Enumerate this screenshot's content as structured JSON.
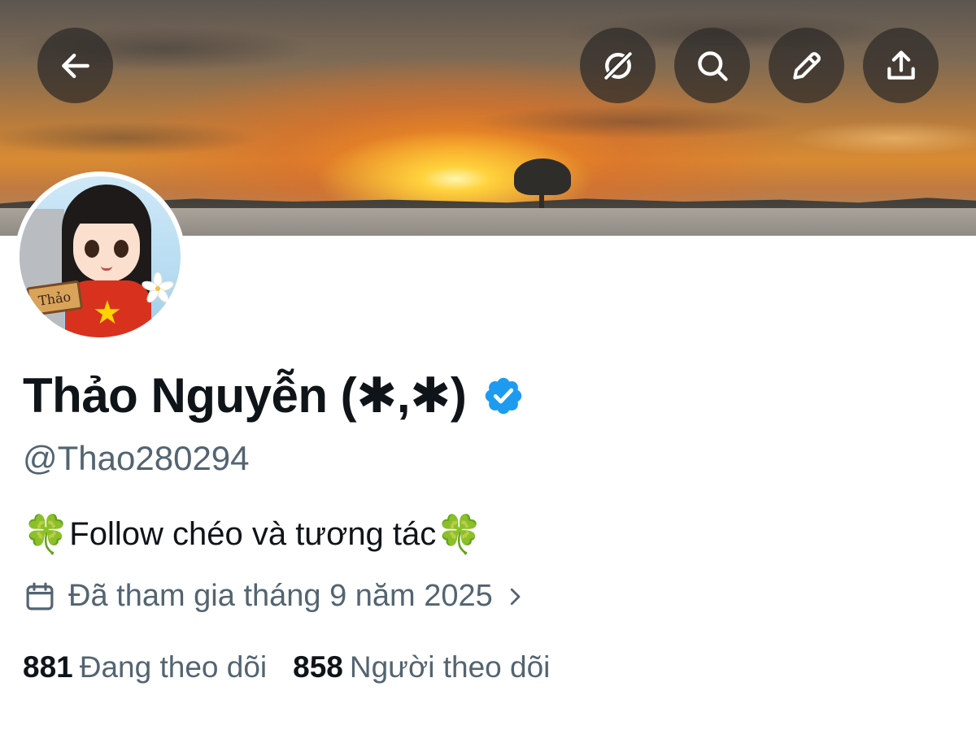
{
  "header": {
    "back_icon": "arrow-left-icon",
    "actions": [
      {
        "icon": "grok-icon"
      },
      {
        "icon": "search-icon"
      },
      {
        "icon": "pencil-icon"
      },
      {
        "icon": "share-icon"
      }
    ]
  },
  "avatar": {
    "sign_text": "Thảo"
  },
  "profile": {
    "display_name": "Thảo Nguyễn (✱,✱)",
    "verified": true,
    "verified_color": "#1d9bf0",
    "handle": "@Thao280294",
    "bio": {
      "emoji_left": "🍀",
      "text": "Follow chéo và tương tác",
      "emoji_right": "🍀"
    },
    "joined": "Đã tham gia tháng 9 năm 2025",
    "following": {
      "count": "881",
      "label": "Đang theo dõi"
    },
    "followers": {
      "count": "858",
      "label": "Người theo dõi"
    }
  },
  "colors": {
    "text_primary": "#0f1419",
    "text_secondary": "#536471",
    "button_bg": "#2d2a28"
  }
}
